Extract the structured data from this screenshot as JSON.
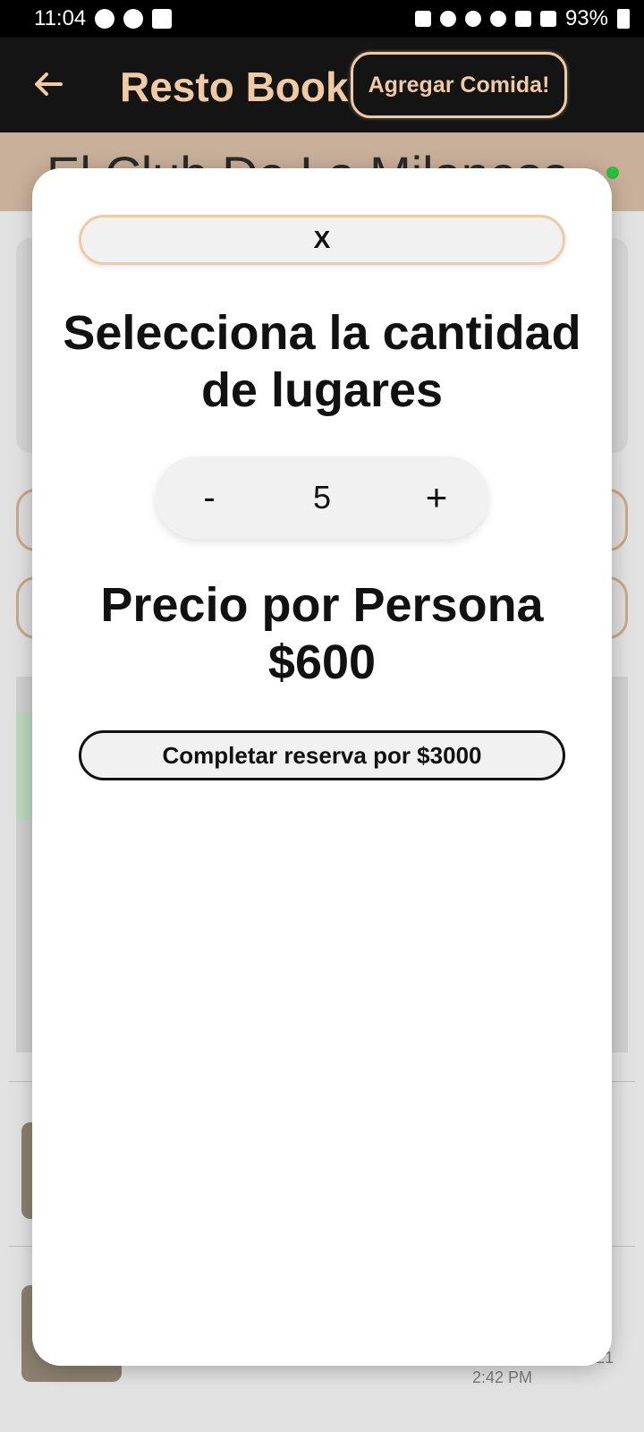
{
  "status_bar": {
    "time": "11:04",
    "battery": "93%",
    "left_icons": [
      "whatsapp-icon",
      "app-notification-icon",
      "image-icon"
    ],
    "right_icons": [
      "battery-saver-icon",
      "alarm-icon",
      "mute-icon",
      "hotspot-icon",
      "4g-icon",
      "signal-icon",
      "battery-icon"
    ]
  },
  "header": {
    "title": "Resto Book",
    "add_food_label": "Agregar Comida!",
    "back_icon": "arrow-left-icon",
    "accent_color": "#f0caa4",
    "background_color": "#141414"
  },
  "background": {
    "restaurant_name": "El Club De La Milanesa",
    "review_date": "December 16, 2021",
    "review_time": "2:42 PM",
    "status_color": "#2fbf3f"
  },
  "modal": {
    "close_label": "X",
    "heading": "Selecciona la cantidad de lugares",
    "stepper": {
      "minus_label": "-",
      "value": "5",
      "plus_label": "+"
    },
    "price_title": "Precio por Persona",
    "price_value": "$600",
    "complete_label": "Completar reserva por $3000"
  }
}
